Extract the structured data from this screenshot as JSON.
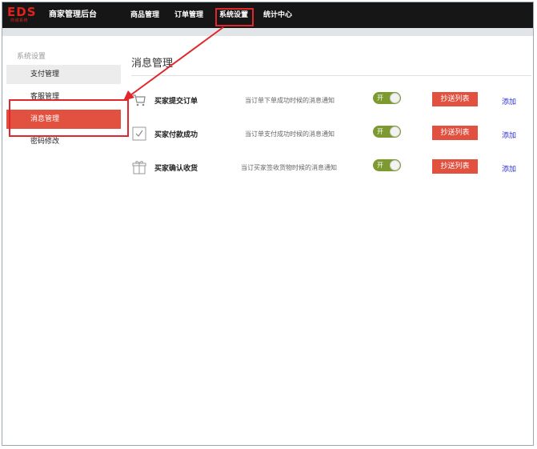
{
  "header": {
    "logo_text": "EDS",
    "logo_sub": "商城系统",
    "app_title": "商家管理后台",
    "nav": [
      {
        "label": "商品管理"
      },
      {
        "label": "订单管理"
      },
      {
        "label": "系统设置"
      },
      {
        "label": "统计中心"
      }
    ],
    "active_nav": "系统设置"
  },
  "sidebar": {
    "title": "系统设置",
    "items": [
      {
        "label": "支付管理"
      },
      {
        "label": "客服管理"
      },
      {
        "label": "消息管理"
      },
      {
        "label": "密码修改"
      }
    ],
    "active_item": "消息管理"
  },
  "main": {
    "title": "消息管理",
    "rows": [
      {
        "icon": "cart-icon",
        "name": "买家提交订单",
        "desc": "当订单下单成功时候的消息通知",
        "toggle": "开",
        "button": "抄送列表",
        "link": "添加"
      },
      {
        "icon": "check-icon",
        "name": "买家付款成功",
        "desc": "当订单支付成功时候的消息通知",
        "toggle": "开",
        "button": "抄送列表",
        "link": "添加"
      },
      {
        "icon": "gift-icon",
        "name": "买家确认收货",
        "desc": "当订买家签收货物时候的消息通知",
        "toggle": "开",
        "button": "抄送列表",
        "link": "添加"
      }
    ]
  },
  "colors": {
    "topbar": "#161616",
    "accent": "#e2513f",
    "highlight_border": "#e2262b",
    "toggle_on": "#7c9a2f",
    "link": "#2f2fd0"
  }
}
